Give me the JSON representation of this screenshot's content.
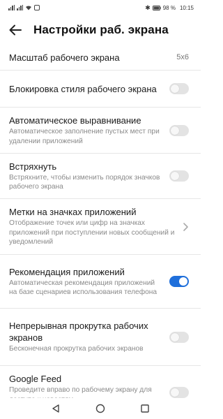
{
  "status_bar": {
    "battery": "98 %",
    "time": "10:15"
  },
  "header": {
    "title": "Настройки раб. экрана"
  },
  "settings": [
    {
      "title": "Масштаб рабочего экрана",
      "value": "5x6"
    },
    {
      "title": "Блокировка стиля рабочего экрана",
      "toggle_on": false
    },
    {
      "title": "Автоматическое выравнивание",
      "subtitle": "Автоматическое заполнение пустых мест при удалении приложений",
      "toggle_on": false
    },
    {
      "title": "Встряхнуть",
      "subtitle": "Встряхните, чтобы изменить порядок значков рабочего экрана",
      "toggle_on": false
    },
    {
      "title": "Метки на значках приложений",
      "subtitle": "Отображение точек или цифр на значках приложений при поступлении новых сообщений и уведомлений"
    },
    {
      "title": "Рекомендация приложений",
      "subtitle": "Автоматическая рекомендация приложений на базе сценариев использования телефона",
      "toggle_on": true
    },
    {
      "title": "Непрерывная прокрутка рабочих экранов",
      "subtitle": "Бесконечная прокрутка рабочих экранов",
      "toggle_on": false
    },
    {
      "title": "Google Feed",
      "subtitle": "Проведите вправо по рабочему экрану для доступа к новостям,",
      "toggle_on": false
    }
  ],
  "icons": {
    "back": "back-arrow-icon",
    "nav_back": "triangle-back-icon",
    "nav_home": "circle-home-icon",
    "nav_recents": "square-recents-icon"
  },
  "colors": {
    "accent": "#1f6fdb",
    "toggle_off": "#e3e3e3"
  }
}
